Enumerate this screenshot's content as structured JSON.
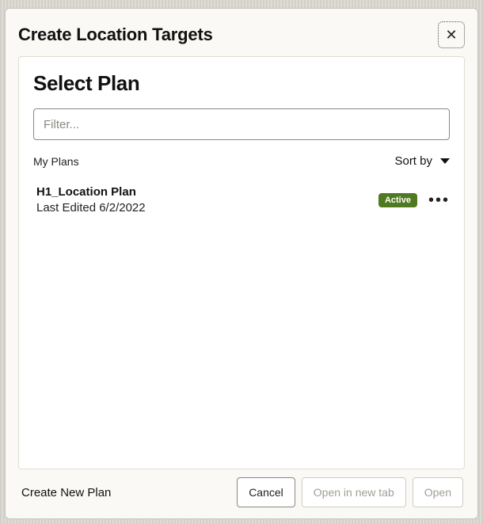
{
  "header": {
    "title": "Create Location Targets"
  },
  "panel": {
    "title": "Select Plan",
    "filter_placeholder": "Filter..."
  },
  "list_header": {
    "left": "My Plans",
    "sort_label": "Sort by"
  },
  "plans": [
    {
      "name": "H1_Location Plan",
      "subtitle": "Last Edited 6/2/2022",
      "status": "Active"
    }
  ],
  "footer": {
    "create_new": "Create New Plan",
    "cancel": "Cancel",
    "open_new_tab": "Open in new tab",
    "open": "Open"
  }
}
